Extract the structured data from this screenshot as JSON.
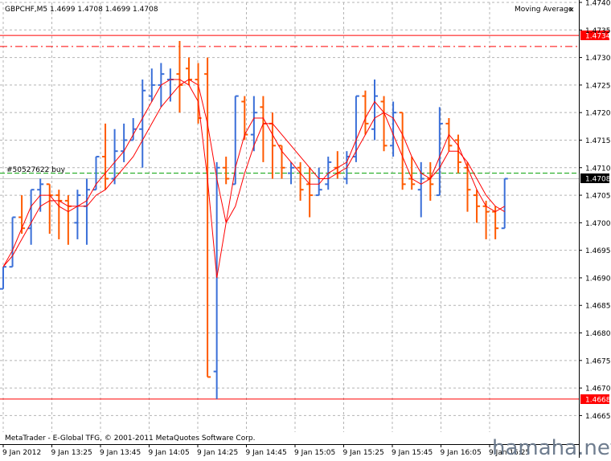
{
  "chart": {
    "symbol_label": "GBPCHF,M5",
    "ohlc_label": "1.4699 1.4708 1.4699 1.4708",
    "indicator_label": "Moving Average",
    "close_glyph": "✕",
    "order_label": "#50527622 buy",
    "copyright": "MetaTrader - E-Global TFG, © 2001-2011 MetaQuotes Software Corp.",
    "watermark": "hamaha.net"
  },
  "chart_data": {
    "type": "ohlc",
    "symbol": "GBPCHF",
    "timeframe": "M5",
    "y_axis": {
      "range": [
        1.4662,
        1.474
      ],
      "ticks": [
        "1.4740",
        "1.4735",
        "1.4730",
        "1.4725",
        "1.4720",
        "1.4715",
        "1.4710",
        "1.4705",
        "1.4700",
        "1.4695",
        "1.4690",
        "1.4685",
        "1.4680",
        "1.4675",
        "1.4670",
        "1.4665"
      ]
    },
    "x_axis": {
      "ticks": [
        "9 Jan 2012",
        "9 Jan 13:25",
        "9 Jan 13:45",
        "9 Jan 14:05",
        "9 Jan 14:25",
        "9 Jan 14:45",
        "9 Jan 15:05",
        "9 Jan 15:25",
        "9 Jan 15:45",
        "9 Jan 16:05",
        "9 Jan 16:25"
      ]
    },
    "grid": true,
    "colors": {
      "bull": "#3a6fd8",
      "bear": "#ff5a00",
      "ma": "#ff0000",
      "order": "#00a000",
      "level": "#ff0000",
      "grid": "#b4b4b4"
    },
    "levels": [
      {
        "price": 1.4734,
        "label": "1.4734",
        "style": "solid"
      },
      {
        "price": 1.4732,
        "label": "",
        "style": "dashdot"
      },
      {
        "price": 1.4668,
        "label": "1.4668",
        "style": "solid"
      }
    ],
    "order_line": {
      "price": 1.4709,
      "label": "#50527622 buy"
    },
    "current_price": {
      "price": 1.4708,
      "label": "1.4708"
    },
    "bars": [
      [
        1.4688,
        1.4692,
        1.4688,
        1.4692
      ],
      [
        1.4692,
        1.4701,
        1.4692,
        1.4701
      ],
      [
        1.4701,
        1.4705,
        1.4698,
        1.4699
      ],
      [
        1.4699,
        1.4706,
        1.4696,
        1.4706
      ],
      [
        1.4706,
        1.4708,
        1.4702,
        1.4707
      ],
      [
        1.4707,
        1.4707,
        1.4698,
        1.4705
      ],
      [
        1.4705,
        1.4706,
        1.4697,
        1.4704
      ],
      [
        1.4704,
        1.4705,
        1.4696,
        1.4703
      ],
      [
        1.47,
        1.4706,
        1.4697,
        1.4705
      ],
      [
        1.4703,
        1.4708,
        1.4696,
        1.4706
      ],
      [
        1.4706,
        1.4712,
        1.4706,
        1.4712
      ],
      [
        1.4712,
        1.4718,
        1.4706,
        1.4708
      ],
      [
        1.4708,
        1.4717,
        1.4707,
        1.4713
      ],
      [
        1.4713,
        1.4718,
        1.4711,
        1.4715
      ],
      [
        1.4715,
        1.4719,
        1.4715,
        1.4717
      ],
      [
        1.4717,
        1.4726,
        1.471,
        1.4724
      ],
      [
        1.4723,
        1.4728,
        1.4722,
        1.4725
      ],
      [
        1.4725,
        1.4729,
        1.4721,
        1.4727
      ],
      [
        1.4726,
        1.4728,
        1.4722,
        1.4726
      ],
      [
        1.4727,
        1.4733,
        1.472,
        1.4725
      ],
      [
        1.4728,
        1.473,
        1.4725,
        1.4726
      ],
      [
        1.4726,
        1.4729,
        1.4718,
        1.4719
      ],
      [
        1.4727,
        1.473,
        1.4672,
        1.4672
      ],
      [
        1.4673,
        1.4711,
        1.4668,
        1.471
      ],
      [
        1.471,
        1.4712,
        1.4707,
        1.4708
      ],
      [
        1.4707,
        1.4723,
        1.4707,
        1.4723
      ],
      [
        1.4722,
        1.4723,
        1.4715,
        1.4716
      ],
      [
        1.4716,
        1.4723,
        1.4713,
        1.472
      ],
      [
        1.4721,
        1.4723,
        1.4711,
        1.4718
      ],
      [
        1.4718,
        1.472,
        1.4708,
        1.4714
      ],
      [
        1.4714,
        1.4714,
        1.4708,
        1.471
      ],
      [
        1.4709,
        1.4711,
        1.4707,
        1.471
      ],
      [
        1.471,
        1.4711,
        1.4704,
        1.4706
      ],
      [
        1.4707,
        1.471,
        1.4701,
        1.4705
      ],
      [
        1.4705,
        1.471,
        1.4705,
        1.4706
      ],
      [
        1.4707,
        1.4712,
        1.4706,
        1.4711
      ],
      [
        1.471,
        1.4713,
        1.4708,
        1.4709
      ],
      [
        1.4708,
        1.4713,
        1.4707,
        1.4712
      ],
      [
        1.4712,
        1.4723,
        1.4711,
        1.4723
      ],
      [
        1.4723,
        1.4724,
        1.4716,
        1.4718
      ],
      [
        1.4717,
        1.4726,
        1.4715,
        1.4723
      ],
      [
        1.4722,
        1.4723,
        1.4713,
        1.4714
      ],
      [
        1.4714,
        1.4722,
        1.4712,
        1.472
      ],
      [
        1.472,
        1.472,
        1.4706,
        1.4707
      ],
      [
        1.4708,
        1.4712,
        1.4706,
        1.4707
      ],
      [
        1.4706,
        1.4711,
        1.4701,
        1.4708
      ],
      [
        1.4708,
        1.4711,
        1.4704,
        1.4707
      ],
      [
        1.4705,
        1.4721,
        1.4705,
        1.4718
      ],
      [
        1.4718,
        1.4719,
        1.4713,
        1.4714
      ],
      [
        1.4715,
        1.4716,
        1.4709,
        1.4711
      ],
      [
        1.471,
        1.4711,
        1.4702,
        1.4706
      ],
      [
        1.4705,
        1.4706,
        1.47,
        1.4703
      ],
      [
        1.4703,
        1.4704,
        1.4697,
        1.4702
      ],
      [
        1.4702,
        1.4703,
        1.4697,
        1.4699
      ],
      [
        1.4699,
        1.4708,
        1.4699,
        1.4708
      ]
    ],
    "ma_fast": [
      1.4692,
      1.4695,
      1.4699,
      1.4703,
      1.4705,
      1.4705,
      1.4703,
      1.4702,
      1.4703,
      1.4704,
      1.4707,
      1.4709,
      1.4711,
      1.4713,
      1.4716,
      1.4719,
      1.4722,
      1.4725,
      1.4726,
      1.4726,
      1.4725,
      1.4722,
      1.4708,
      1.469,
      1.47,
      1.471,
      1.4716,
      1.4719,
      1.4719,
      1.4716,
      1.4713,
      1.4711,
      1.4709,
      1.4707,
      1.4707,
      1.4709,
      1.471,
      1.4711,
      1.4715,
      1.4719,
      1.4722,
      1.472,
      1.4716,
      1.4712,
      1.4708,
      1.4707,
      1.4708,
      1.4712,
      1.4716,
      1.4714,
      1.471,
      1.4706,
      1.4703,
      1.4702,
      1.4703
    ],
    "ma_slow": [
      1.4692,
      1.4694,
      1.4697,
      1.47,
      1.4703,
      1.4704,
      1.4704,
      1.4703,
      1.4703,
      1.4703,
      1.4705,
      1.4706,
      1.4708,
      1.471,
      1.4712,
      1.4715,
      1.4718,
      1.4721,
      1.4723,
      1.4725,
      1.4726,
      1.4725,
      1.4718,
      1.4708,
      1.47,
      1.4703,
      1.4709,
      1.4714,
      1.4718,
      1.4718,
      1.4716,
      1.4714,
      1.4712,
      1.471,
      1.4708,
      1.4708,
      1.4709,
      1.471,
      1.4713,
      1.4716,
      1.4719,
      1.472,
      1.4719,
      1.4716,
      1.4712,
      1.4709,
      1.4708,
      1.471,
      1.4713,
      1.4713,
      1.4711,
      1.4708,
      1.4705,
      1.4703,
      1.4702
    ]
  }
}
